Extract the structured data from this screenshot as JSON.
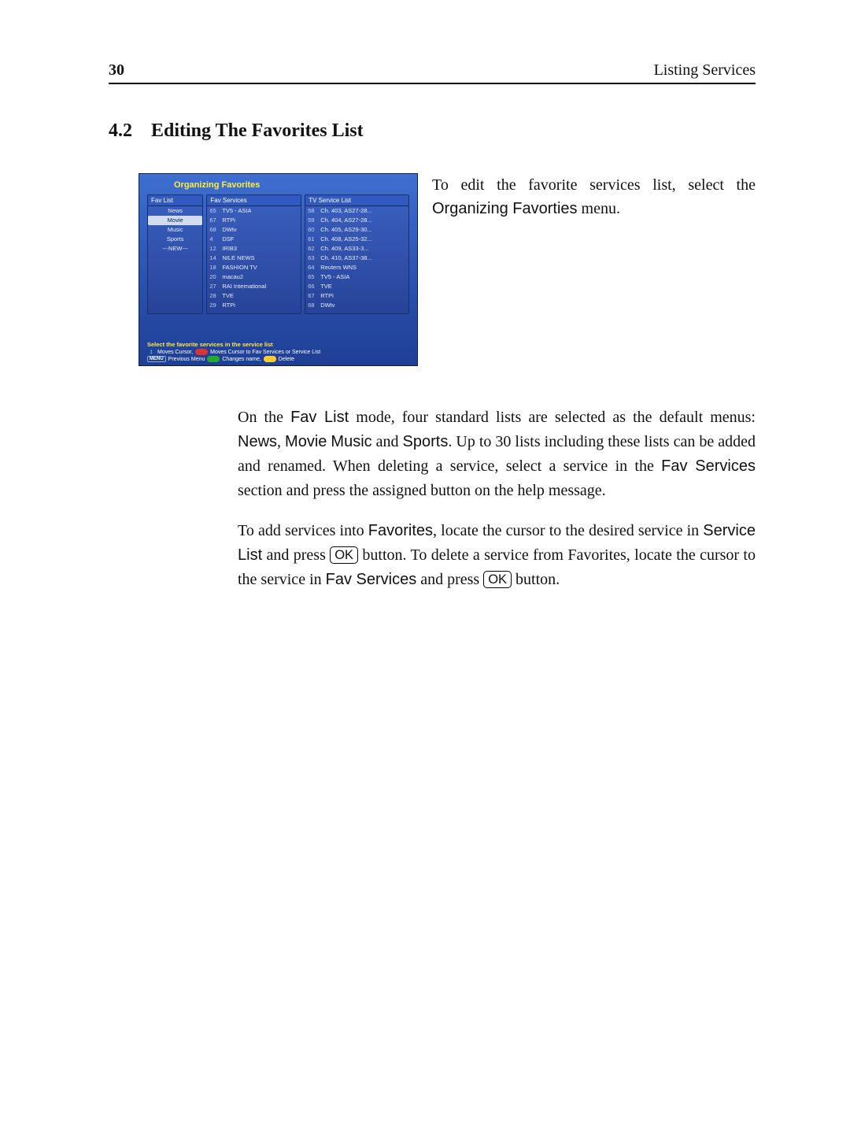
{
  "header": {
    "page_number": "30",
    "chapter_title": "Listing Services"
  },
  "section": {
    "number": "4.2",
    "title": "Editing The Favorites List"
  },
  "intro": {
    "line1": "To edit the favorite services list, select the",
    "menu_name": "Organizing Favorties",
    "line2": "menu."
  },
  "screenshot": {
    "title": "Organizing Favorites",
    "fav_list": {
      "header": "Fav List",
      "items": [
        "News",
        "Movie",
        "Music",
        "Sports",
        "---NEW---"
      ],
      "selected_index": 1
    },
    "fav_services": {
      "header": "Fav Services",
      "rows": [
        {
          "num": "65",
          "name": "TV5 - ASIA"
        },
        {
          "num": "67",
          "name": "RTPi"
        },
        {
          "num": "68",
          "name": "DWtv"
        },
        {
          "num": "4",
          "name": "DSF"
        },
        {
          "num": "12",
          "name": "IRIB3"
        },
        {
          "num": "14",
          "name": "NILE NEWS"
        },
        {
          "num": "18",
          "name": "FASHION TV"
        },
        {
          "num": "20",
          "name": "macau2"
        },
        {
          "num": "27",
          "name": "RAI International"
        },
        {
          "num": "28",
          "name": "TVE"
        },
        {
          "num": "29",
          "name": "RTPi"
        }
      ]
    },
    "service_list": {
      "header": "TV Service List",
      "rows": [
        {
          "num": "58",
          "name": "Ch. 403, AS27-28..."
        },
        {
          "num": "59",
          "name": "Ch. 404, AS27-28..."
        },
        {
          "num": "60",
          "name": "Ch. 405, AS29-30..."
        },
        {
          "num": "61",
          "name": "Ch. 408, AS25-32..."
        },
        {
          "num": "62",
          "name": "Ch. 409, AS33-3..."
        },
        {
          "num": "63",
          "name": "Ch. 410, AS37-38..."
        },
        {
          "num": "64",
          "name": "Reuters WNS"
        },
        {
          "num": "65",
          "name": "TV5 - ASIA"
        },
        {
          "num": "66",
          "name": "TVE"
        },
        {
          "num": "67",
          "name": "RTPi"
        },
        {
          "num": "68",
          "name": "DWtv"
        }
      ]
    },
    "help": {
      "line1": "Select the favorite services in the service list",
      "moves_cursor": "Moves Cursor,",
      "moves_cursor_to": "Moves Cursor to Fav Services or Service List",
      "menu_label": "MENU",
      "previous_menu": "Previous Menu",
      "changes_name": "Changes name,",
      "delete": "Delete"
    }
  },
  "body": {
    "p1_a": "On the ",
    "p1_b": "Fav List",
    "p1_c": " mode, four standard lists are selected as the default menus: ",
    "p1_d": "News",
    "p1_e": ", ",
    "p1_f": "Movie",
    "p1_g": " ",
    "p1_h": "Music",
    "p1_i": " and ",
    "p1_j": "Sports",
    "p1_k": ". Up to 30 lists including these lists can be added and renamed. When deleting a service, select a service in the ",
    "p1_l": "Fav Services",
    "p1_m": " section and press the assigned button on the help message.",
    "p2_a": "To add services into ",
    "p2_b": "Favorites",
    "p2_c": ", locate the cursor to the desired service in ",
    "p2_d": "Service List",
    "p2_e": " and press ",
    "p2_ok1": "OK",
    "p2_f": " button. To delete a service from Favorites, locate the cursor to the service in ",
    "p2_g": "Fav Services",
    "p2_h": " and press ",
    "p2_ok2": "OK",
    "p2_i": " button."
  }
}
